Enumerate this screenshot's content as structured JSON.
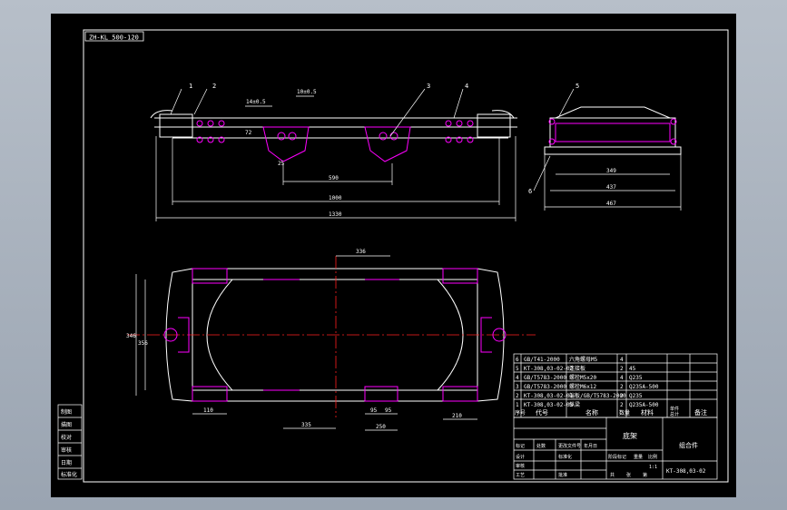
{
  "drawing": {
    "code_tag": "ZH-KL 500-120",
    "title_block": {
      "part_name": "底架",
      "assembly": "组合件",
      "drawing_no": "KT-308,03-02",
      "headers": [
        "序号",
        "代号",
        "名称",
        "数量",
        "材料",
        "单件",
        "总计",
        "备注"
      ],
      "row_labels": [
        "标记",
        "处数",
        "分区",
        "更改文件号",
        "签名",
        "年月日",
        "设计",
        "标准化",
        "阶段标记",
        "重量",
        "比例",
        "审核",
        "工艺",
        "批准",
        "共",
        "张",
        "第"
      ],
      "scale": "1:1"
    },
    "parts_list": [
      {
        "no": "6",
        "code": "GB/T41-2000",
        "name": "六角螺母M5",
        "qty": "4"
      },
      {
        "no": "5",
        "code": "KT-308,03-02-02",
        "name": "连接板",
        "qty": "2",
        "material": "45"
      },
      {
        "no": "4",
        "code": "GB/T5783-2000",
        "name": "螺栓M5x20",
        "qty": "4",
        "material": "Q235"
      },
      {
        "no": "3",
        "code": "GB/T5783-2000",
        "name": "螺栓M6x12",
        "qty": "2",
        "material": "Q235A-500"
      },
      {
        "no": "2",
        "code": "KT-308,03-02-01",
        "name": "端板/GB/T5783-2000",
        "qty": "2",
        "material": "Q235"
      },
      {
        "no": "1",
        "code": "KT-308,03-02-03",
        "name": "纵梁",
        "qty": "2",
        "material": "Q235A-500"
      }
    ],
    "dimensions": {
      "d_top_1": "14±0.5",
      "d_top_2": "10±0.5",
      "d_top_3": "72",
      "d_top_4": "590",
      "d_top_5": "1000",
      "d_top_6": "1330",
      "d_top_7": "25",
      "d_side_1": "349",
      "d_side_2": "437",
      "d_side_3": "467",
      "d_plan_top": "336",
      "d_plan_h1": "346",
      "d_plan_h2": "356",
      "d_plan_b1": "110",
      "d_plan_b2": "335",
      "d_plan_b3": "95",
      "d_plan_b4": "95",
      "d_plan_b5": "250",
      "d_plan_b6": "210"
    },
    "balloons": [
      "1",
      "2",
      "3",
      "4",
      "5",
      "6"
    ],
    "left_strip": [
      "制图",
      "描图",
      "校对",
      "审核",
      "日期",
      "标准化"
    ],
    "colors": {
      "paper": "#000000",
      "line": "#ffffff",
      "part": "#ff00ff",
      "center": "#ff2020",
      "dim": "#ffffff"
    }
  }
}
